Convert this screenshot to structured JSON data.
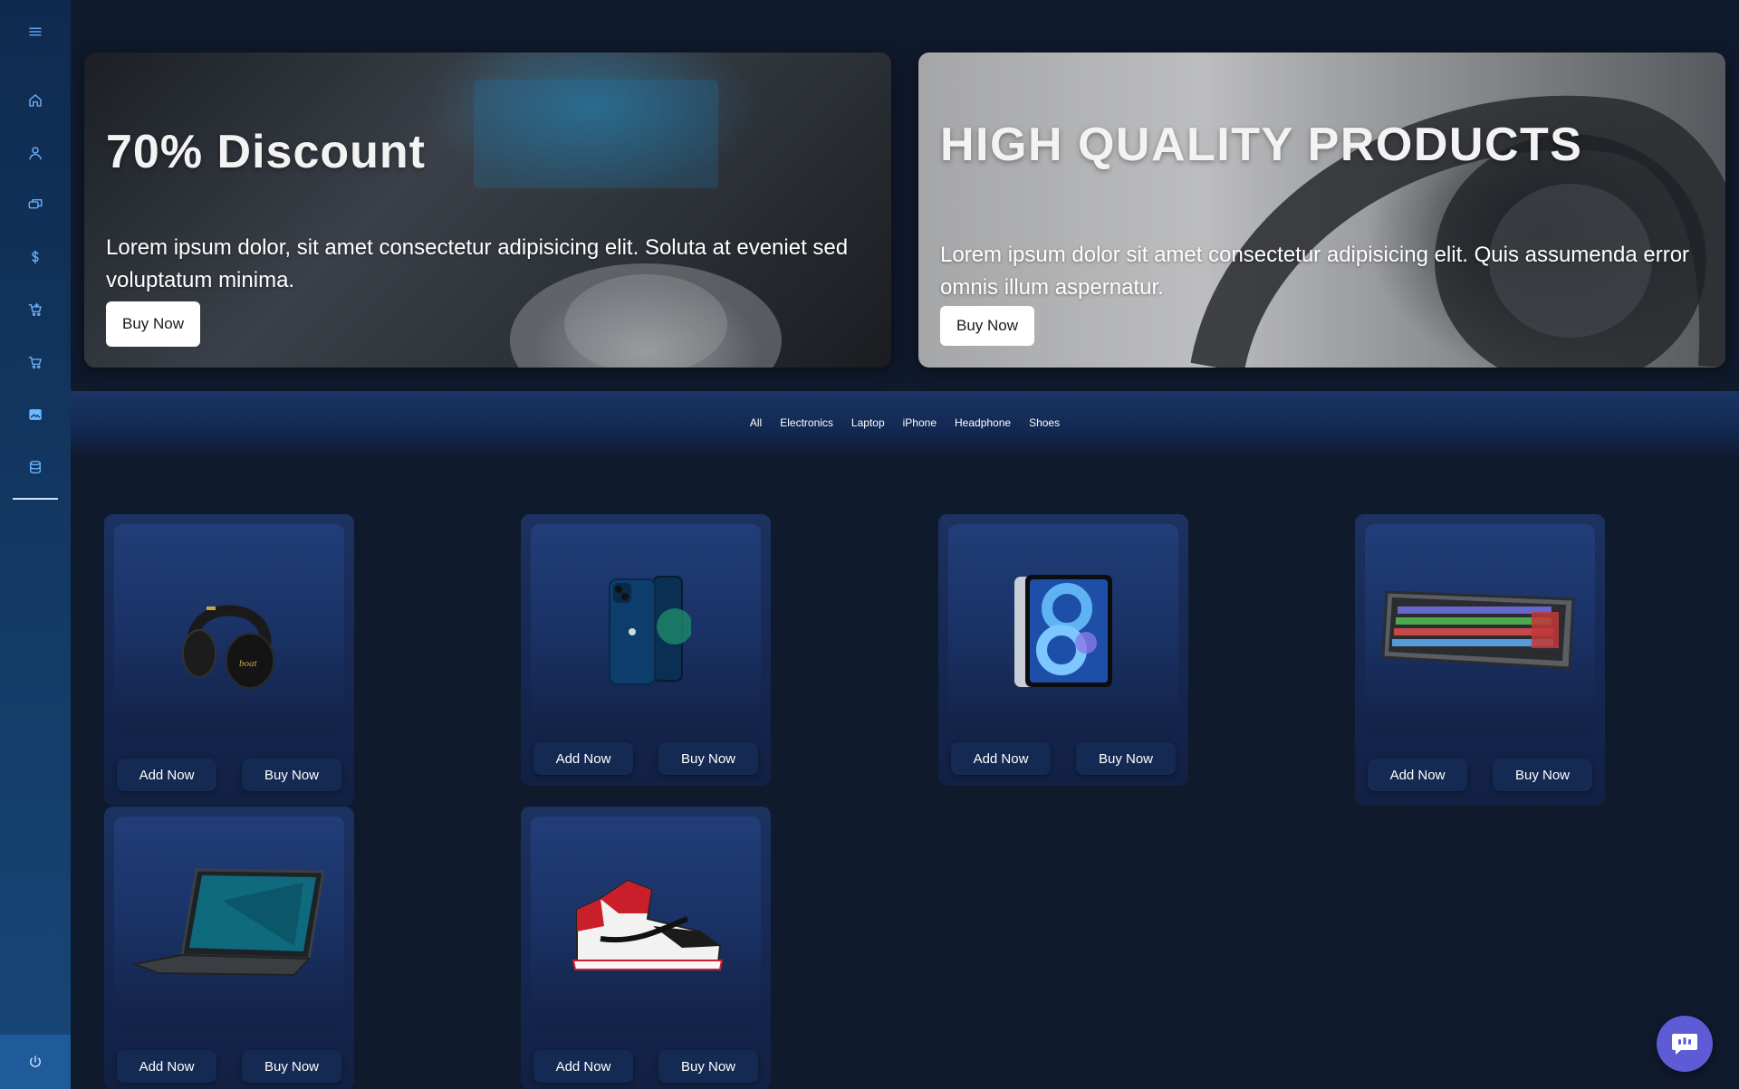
{
  "sidebar": {
    "items": [
      {
        "icon": "menu-icon"
      },
      {
        "icon": "home-icon"
      },
      {
        "icon": "user-icon"
      },
      {
        "icon": "chat-icon"
      },
      {
        "icon": "dollar-icon"
      },
      {
        "icon": "cart-add-icon"
      },
      {
        "icon": "cart-icon"
      },
      {
        "icon": "image-icon"
      },
      {
        "icon": "database-icon"
      }
    ],
    "footer_icon": "power-icon"
  },
  "banners": [
    {
      "title": "70% Discount",
      "text": "Lorem ipsum dolor, sit amet consectetur adipisicing elit. Soluta at eveniet sed voluptatum minima.",
      "button": "Buy Now"
    },
    {
      "title": "HIGH QUALITY PRODUCTS",
      "text": "Lorem ipsum dolor sit amet consectetur adipisicing elit. Quis assumenda error omnis illum aspernatur.",
      "button": "Buy Now"
    }
  ],
  "categories": [
    "All",
    "Electronics",
    "Laptop",
    "iPhone",
    "Headphone",
    "Shoes"
  ],
  "products": [
    {
      "image": "headphones",
      "add_label": "Add Now",
      "buy_label": "Buy Now"
    },
    {
      "image": "iphone",
      "add_label": "Add Now",
      "buy_label": "Buy Now"
    },
    {
      "image": "ipad",
      "add_label": "Add Now",
      "buy_label": "Buy Now"
    },
    {
      "image": "keyboard",
      "add_label": "Add Now",
      "buy_label": "Buy Now"
    },
    {
      "image": "laptop",
      "add_label": "Add Now",
      "buy_label": "Buy Now"
    },
    {
      "image": "sneaker",
      "add_label": "Add Now",
      "buy_label": "Buy Now"
    }
  ],
  "headphone_brand": "boat",
  "chat": {
    "icon": "chat-bubble-icon"
  },
  "colors": {
    "accent": "#6fb7ff",
    "background": "#101a2d",
    "chat": "#5d5bd6"
  }
}
